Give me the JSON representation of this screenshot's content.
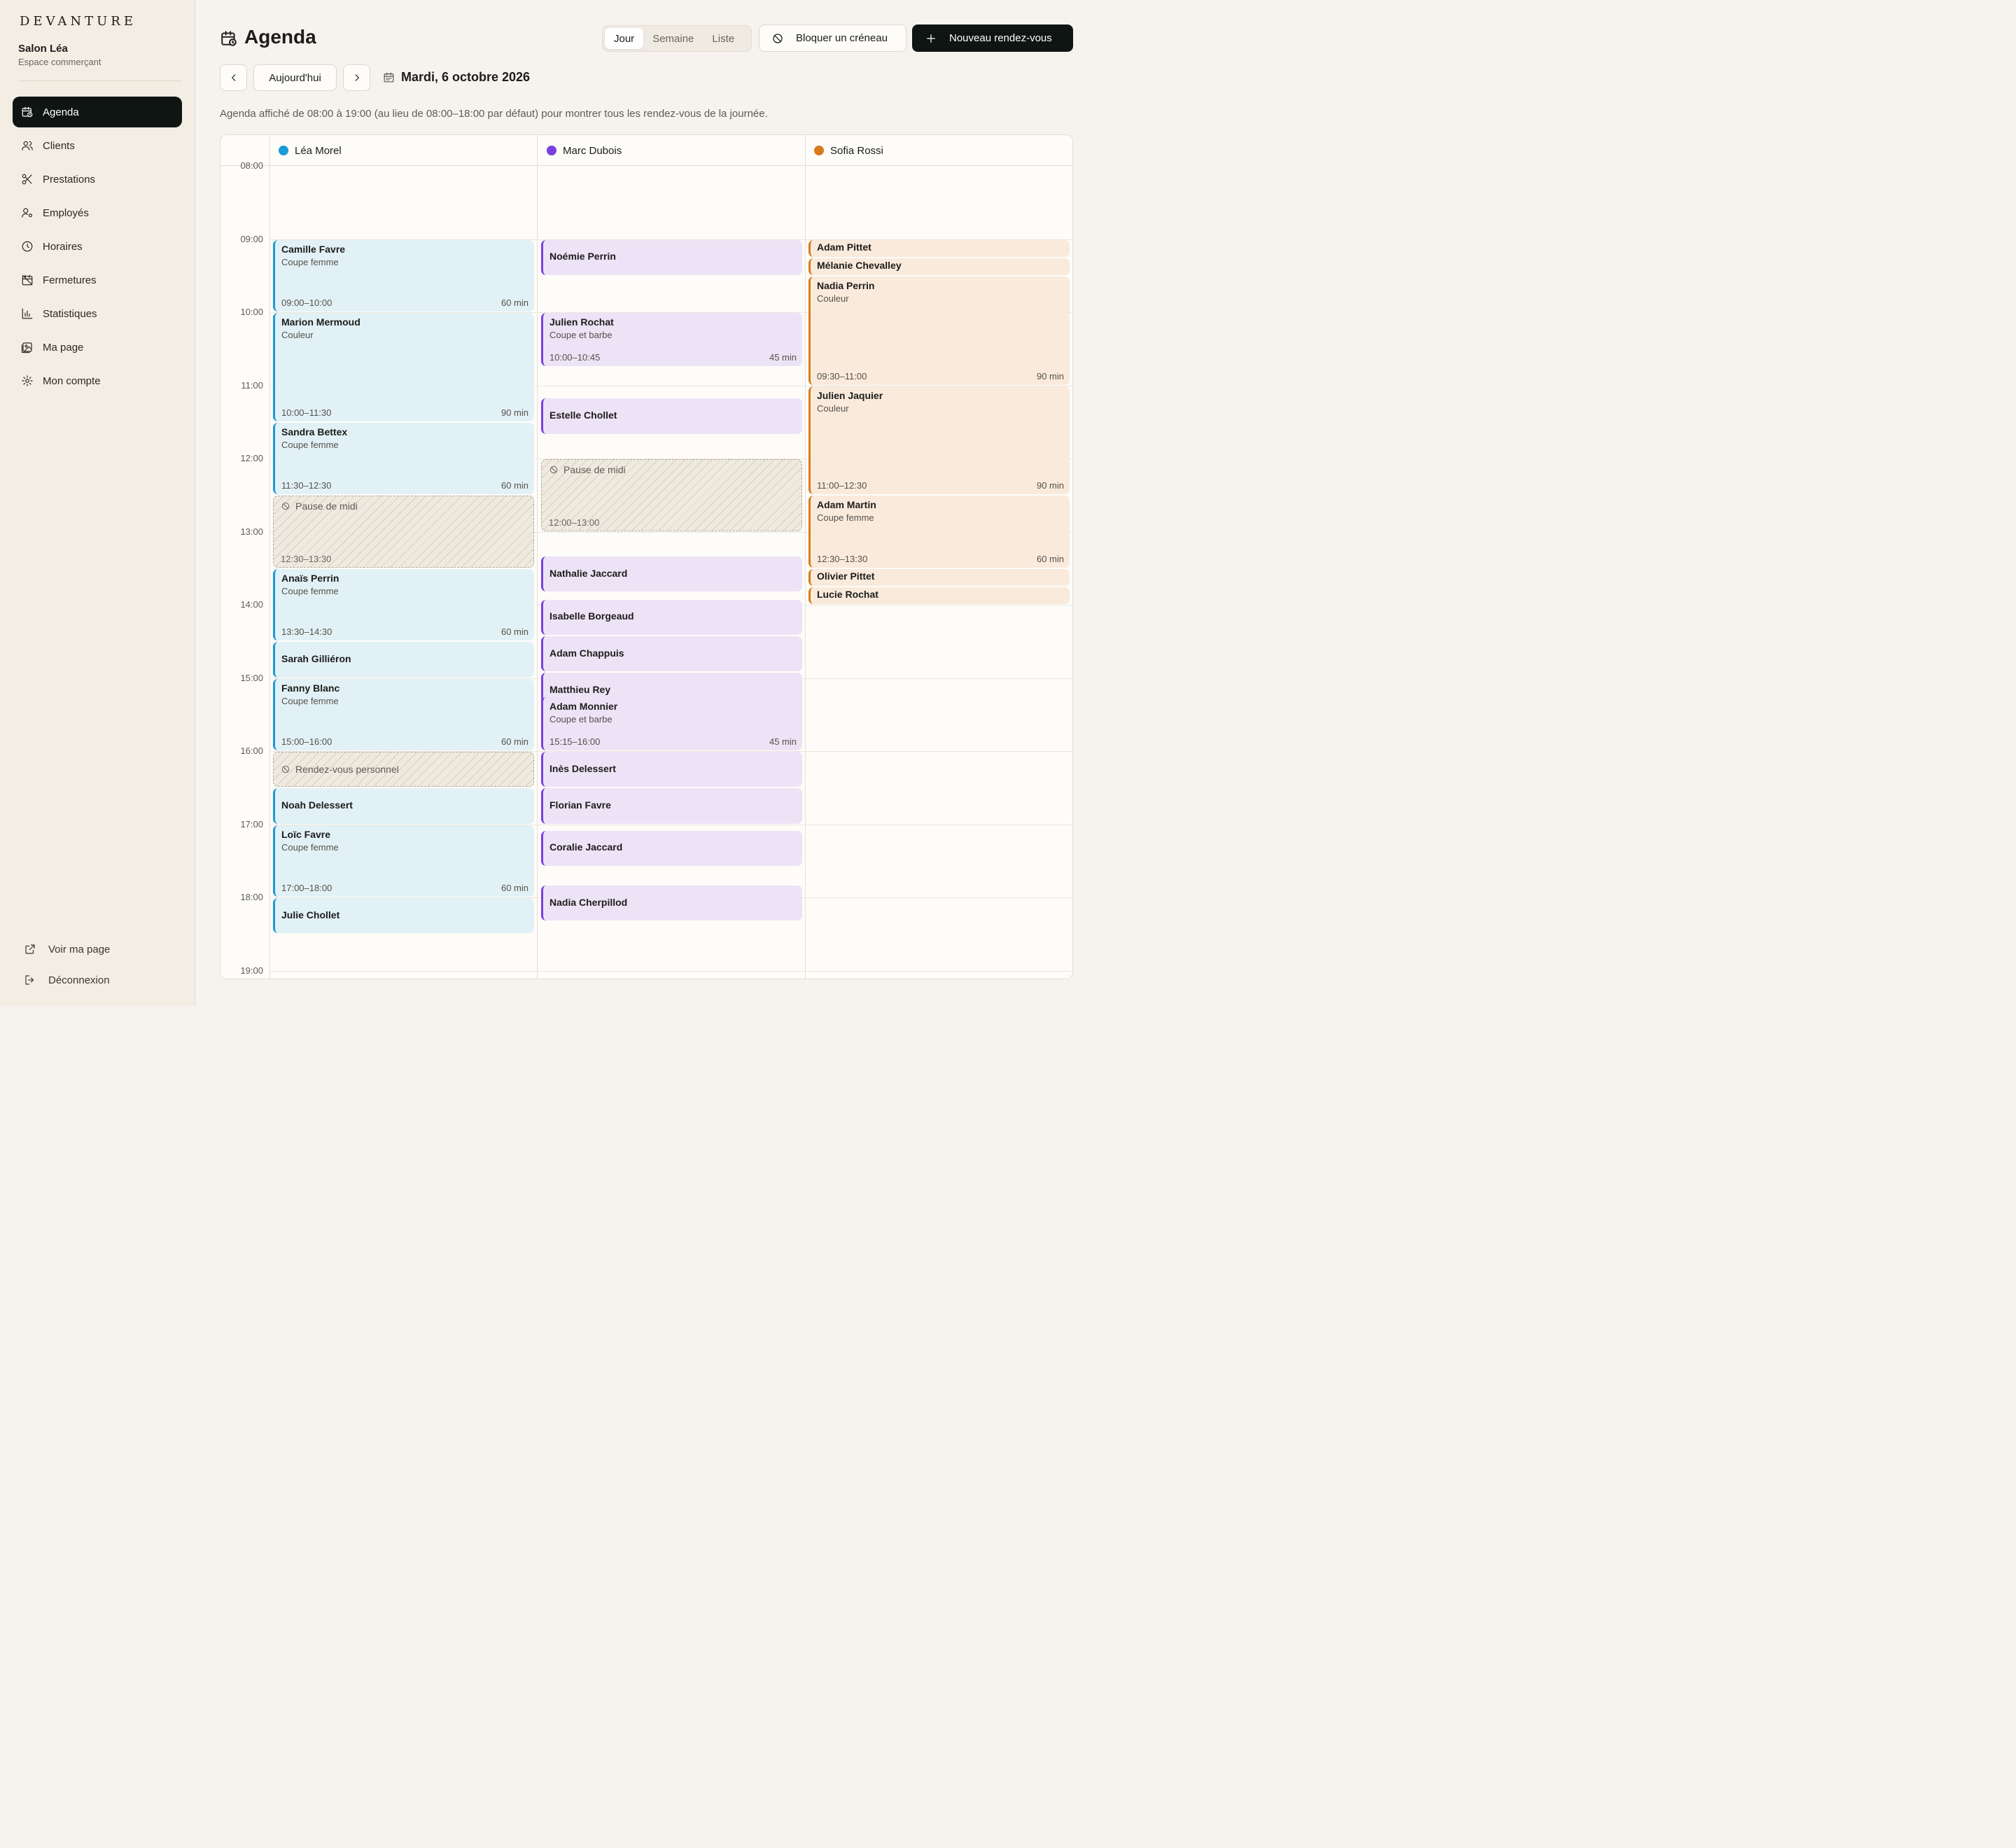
{
  "sidebar": {
    "brand": "DEVANTURE",
    "salon_name": "Salon Léa",
    "salon_sub": "Espace commerçant",
    "items": [
      {
        "label": "Agenda",
        "icon": "calendar-clock-icon",
        "active": true
      },
      {
        "label": "Clients",
        "icon": "users-icon"
      },
      {
        "label": "Prestations",
        "icon": "scissors-icon"
      },
      {
        "label": "Employés",
        "icon": "user-cog-icon"
      },
      {
        "label": "Horaires",
        "icon": "clock-icon"
      },
      {
        "label": "Fermetures",
        "icon": "calendar-off-icon"
      },
      {
        "label": "Statistiques",
        "icon": "bar-chart-icon"
      },
      {
        "label": "Ma page",
        "icon": "image-page-icon"
      },
      {
        "label": "Mon compte",
        "icon": "gear-icon"
      }
    ],
    "view_page": "Voir ma page",
    "logout": "Déconnexion"
  },
  "header": {
    "title": "Agenda",
    "views": [
      "Jour",
      "Semaine",
      "Liste"
    ],
    "active_view": "Jour",
    "block_label": "Bloquer un créneau",
    "new_label": "Nouveau rendez-vous",
    "today_label": "Aujourd'hui",
    "date_label": "Mardi, 6 octobre 2026",
    "notice": "Agenda affiché de 08:00 à 19:00 (au lieu de 08:00–18:00 par défaut) pour montrer tous les rendez-vous de la journée."
  },
  "calendar": {
    "hours": [
      "08:00",
      "09:00",
      "10:00",
      "11:00",
      "12:00",
      "13:00",
      "14:00",
      "15:00",
      "16:00",
      "17:00",
      "18:00",
      "19:00"
    ],
    "colors": {
      "lea": "#1a9ad6",
      "marc": "#7b3fe0",
      "sofia": "#d97a1a"
    },
    "staff": [
      {
        "name": "Léa Morel",
        "key": "lea",
        "events": [
          {
            "client": "Camille Favre",
            "service": "Coupe femme",
            "time": "09:00–10:00",
            "duration": "60 min"
          },
          {
            "client": "Marion Mermoud",
            "service": "Couleur",
            "time": "10:00–11:30",
            "duration": "90 min"
          },
          {
            "client": "Sandra Bettex",
            "service": "Coupe femme",
            "time": "11:30–12:30",
            "duration": "60 min"
          },
          {
            "block": "Pause de midi",
            "time": "12:30–13:30"
          },
          {
            "client": "Anaïs Perrin",
            "service": "Coupe femme",
            "time": "13:30–14:30",
            "duration": "60 min"
          },
          {
            "client": "Sarah Gilliéron"
          },
          {
            "client": "Fanny Blanc",
            "service": "Coupe femme",
            "time": "15:00–16:00",
            "duration": "60 min"
          },
          {
            "block": "Rendez-vous personnel"
          },
          {
            "client": "Noah Delessert"
          },
          {
            "client": "Loïc Favre",
            "service": "Coupe femme",
            "time": "17:00–18:00",
            "duration": "60 min"
          },
          {
            "client": "Julie Chollet"
          }
        ]
      },
      {
        "name": "Marc Dubois",
        "key": "marc",
        "events": [
          {
            "client": "Noémie Perrin"
          },
          {
            "client": "Julien Rochat",
            "service": "Coupe et barbe",
            "time": "10:00–10:45",
            "duration": "45 min"
          },
          {
            "client": "Estelle Chollet"
          },
          {
            "block": "Pause de midi",
            "time": "12:00–13:00"
          },
          {
            "client": "Nathalie Jaccard"
          },
          {
            "client": "Isabelle Borgeaud"
          },
          {
            "client": "Adam Chappuis"
          },
          {
            "client": "Matthieu Rey"
          },
          {
            "client": "Adam Monnier",
            "service": "Coupe et barbe",
            "time": "15:15–16:00",
            "duration": "45 min"
          },
          {
            "client": "Inès Delessert"
          },
          {
            "client": "Florian Favre"
          },
          {
            "client": "Coralie Jaccard"
          },
          {
            "client": "Nadia Cherpillod"
          }
        ]
      },
      {
        "name": "Sofia Rossi",
        "key": "sofia",
        "events": [
          {
            "client": "Adam Pittet"
          },
          {
            "client": "Mélanie Chevalley"
          },
          {
            "client": "Nadia Perrin",
            "service": "Couleur",
            "time": "09:30–11:00",
            "duration": "90 min"
          },
          {
            "client": "Julien Jaquier",
            "service": "Couleur",
            "time": "11:00–12:30",
            "duration": "90 min"
          },
          {
            "client": "Adam Martin",
            "service": "Coupe femme",
            "time": "12:30–13:30",
            "duration": "60 min"
          },
          {
            "client": "Olivier Pittet"
          },
          {
            "client": "Lucie Rochat"
          }
        ]
      }
    ]
  }
}
